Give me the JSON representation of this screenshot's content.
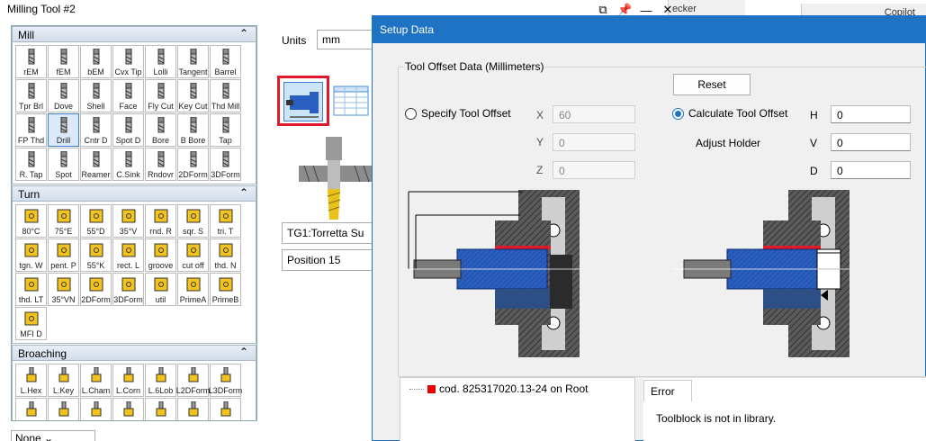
{
  "window": {
    "title": "Milling Tool #2"
  },
  "ribbon": {
    "frag1": "ecker",
    "frag2": "Copilot"
  },
  "palette": {
    "mill": {
      "title": "Mill",
      "items": [
        "rEM",
        "fEM",
        "bEM",
        "Cvx Tip",
        "Lolli",
        "Tangent",
        "Barrel",
        "Tpr Brl",
        "Dove",
        "Shell",
        "Face",
        "Fly Cut",
        "Key Cut",
        "Thd Mill",
        "FP Thd",
        "Drill",
        "Cntr D",
        "Spot D",
        "Bore",
        "B Bore",
        "Tap",
        "R. Tap",
        "Spot",
        "Reamer",
        "C.Sink",
        "Rndovr",
        "2DForm",
        "3DForm"
      ],
      "selected": "Drill"
    },
    "turn": {
      "title": "Turn",
      "items": [
        "80°C",
        "75°E",
        "55°D",
        "35°V",
        "rnd. R",
        "sqr. S",
        "tri. T",
        "tgn. W",
        "pent. P",
        "55°K",
        "rect. L",
        "groove",
        "cut off",
        "thd. N",
        "thd. LT",
        "35°VN",
        "2DForm",
        "3DForm",
        "util",
        "PrimeA",
        "PrimeB",
        "MFI D"
      ]
    },
    "broaching": {
      "title": "Broaching",
      "items": [
        "L.Hex",
        "L.Key",
        "L.Cham",
        "L.Corn",
        "L.6Lob",
        "L2DForm",
        "L3DForm",
        "",
        "",
        "",
        "",
        "",
        "",
        ""
      ]
    }
  },
  "middle": {
    "units_label": "Units",
    "units_value": "mm",
    "toolgroup": "TG1:Torretta Su",
    "position": "Position 15",
    "holder_select": "None"
  },
  "dialog": {
    "title": "Setup Data",
    "group_label": "Tool Offset Data (Millimeters)",
    "reset_label": "Reset",
    "specify_label": "Specify Tool Offset",
    "calculate_label": "Calculate Tool Offset",
    "adjust_label": "Adjust Holder",
    "x_label": "X",
    "y_label": "Y",
    "z_label": "Z",
    "x_value": "60",
    "y_value": "0",
    "z_value": "0",
    "h_label": "H",
    "v_label": "V",
    "d_label": "D",
    "h_value": "0",
    "v_value": "0",
    "d_value": "0",
    "tree_item": "cod. 825317020.13-24 on Root",
    "error_tab": "Error",
    "error_message": "Toolblock is not in library."
  },
  "colors": {
    "accent": "#1f73c4",
    "highlight": "#e01a2a",
    "tool_blue": "#2a5fbf"
  }
}
